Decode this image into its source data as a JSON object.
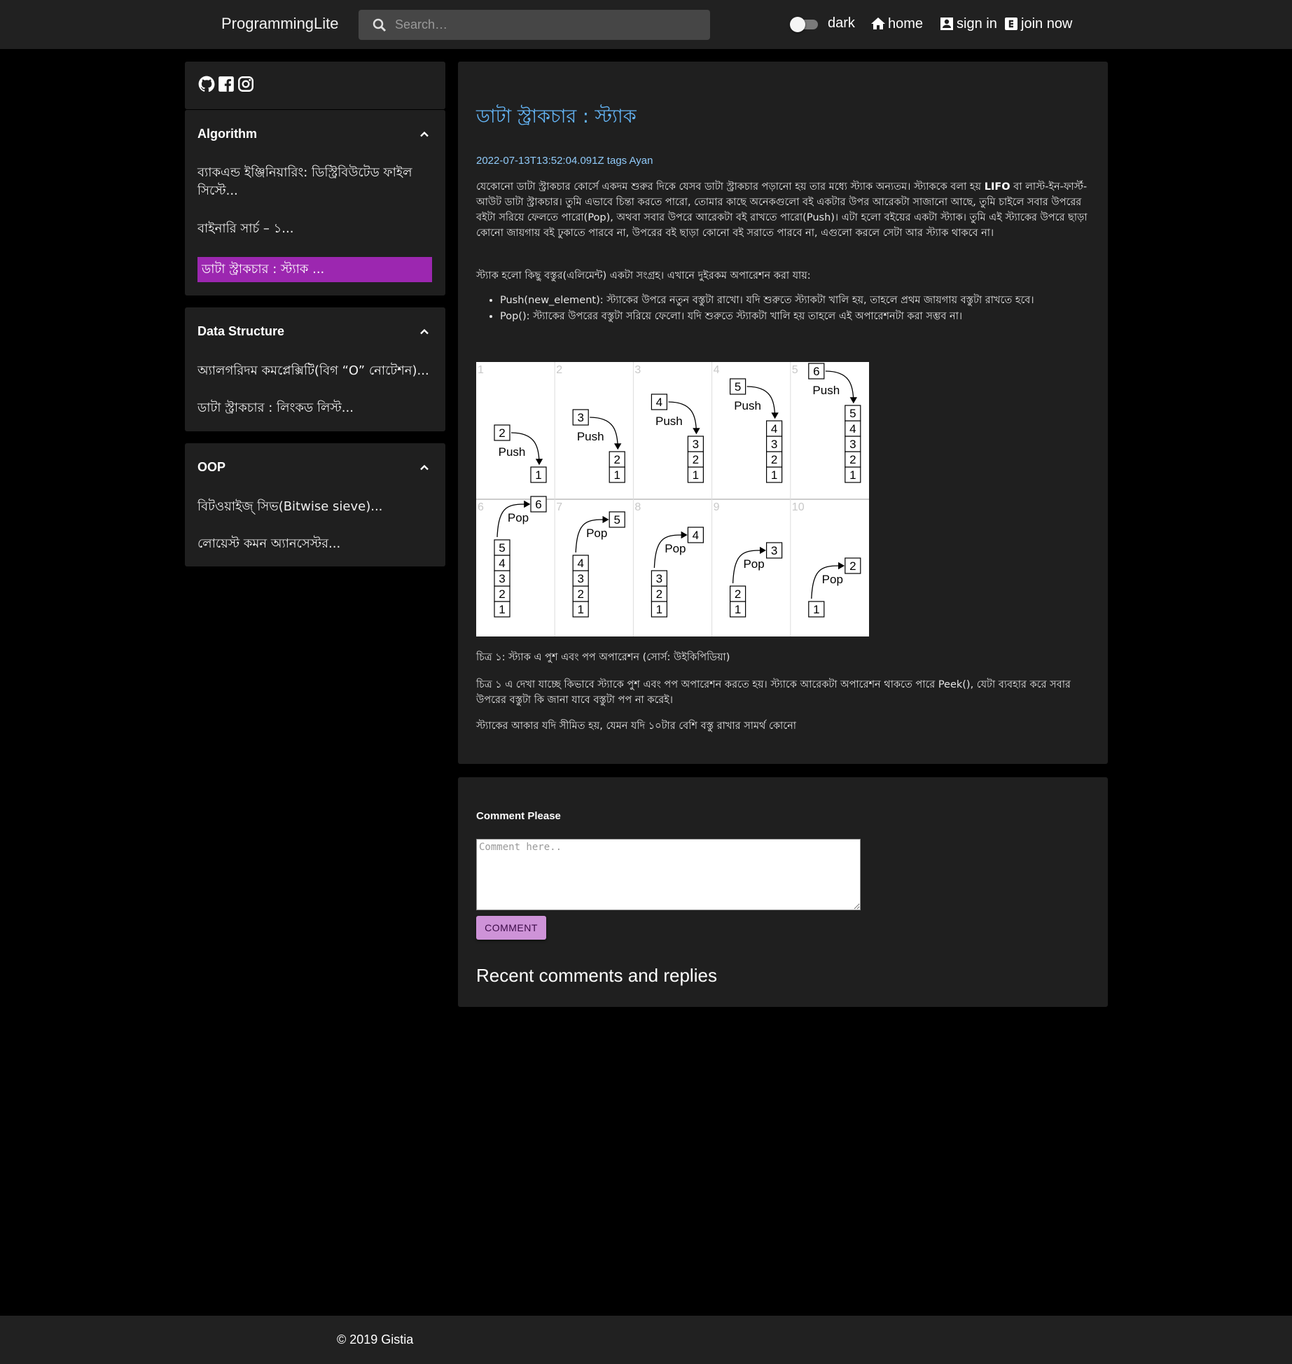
{
  "navbar": {
    "brand": "ProgrammingLite",
    "search_placeholder": "Search…",
    "dark_label": "dark",
    "home_label": "home",
    "signin_label": "sign in",
    "join_label": "join now"
  },
  "sidebar": {
    "sections": [
      {
        "title": "Algorithm",
        "items": [
          "ব্যাকএন্ড ইঞ্জিনিয়ারিং: ডিস্ট্রিবিউটেড ফাইল সিস্টে...",
          "বাইনারি সার্চ – ১...",
          "ডাটা স্ট্রাকচার : স্ট্যাক ..."
        ],
        "active_index": 2
      },
      {
        "title": "Data Structure",
        "items": [
          "অ্যালগরিদম কমপ্লেক্সিটি(বিগ “O” নোটেশন)...",
          "ডাটা স্ট্রাকচার : লিংকড লিস্ট..."
        ]
      },
      {
        "title": "OOP",
        "items": [
          "বিটওয়াইজ্ সিভ(Bitwise sieve)...",
          "লোয়েস্ট কমন অ্যানসেস্টর..."
        ]
      }
    ]
  },
  "article": {
    "title": "ডাটা স্ট্রাকচার : স্ট্যাক",
    "meta": "2022-07-13T13:52:04.091Z tags Ayan",
    "intro_before": "যেকোনো ডাটা স্ট্রাকচার কোর্সে একদম শুরুর দিকে যেসব ডাটা স্ট্রাকচার পড়ানো হয় তার মধ্যে স্ট্যাক অন্যতম। স্ট্যাককে বলা হয় ",
    "intro_bold": "LIFO",
    "intro_after": " বা লাস্ট-ইন-ফার্স্ট-আউট ডাটা স্ট্রাকচার। তুমি এভাবে চিন্তা করতে পারো, তোমার কাছে অনেকগুলো বই একটার উপর আরেকটা সাজানো আছে, তুমি চাইলে সবার উপরের বইটা সরিয়ে ফেলতে পারো(Pop), অথবা সবার উপরে আরেকটা বই রাখতে পারো(Push)। এটা হলো বইয়ের একটা স্ট্যাক। তুমি এই স্ট্যাকের উপরে ছাড়া কোনো জায়গায় বই ঢুকাতে পারবে না, উপরের বই ছাড়া কোনো বই সরাতে পারবে না, এগুলো করলে সেটা আর স্ট্যাক থাকবে না।",
    "collection": "স্ট্যাক হলো কিছু বস্তুর(এলিমেন্ট) একটা সংগ্রহ। এখানে দুইরকম অপারেশন করা যায়:",
    "operations": [
      "Push(new_element): স্ট্যাকের উপরে নতুন বস্তুটা রাখো। যদি শুরুতে স্ট্যাকটা খালি হয়, তাহলে প্রথম জায়গায় বস্তুটা রাখতে হবে।",
      "Pop(): স্ট্যাকের উপরের বস্তুটা সরিয়ে ফেলো। যদি শুরুতে স্ট্যাকটা খালি হয় তাহলে এই অপারেশনটা করা সম্ভব না।"
    ],
    "caption": "চিত্র ১: স্ট্যাক এ পুশ এবং পপ অপারেশন (সোর্স: উইকিপিডিয়া)",
    "peek_para": "চিত্র ১ এ দেখা যাচ্ছে কিভাবে স্ট্যাকে পুশ এবং পপ অপারেশন করতে হয়। স্ট্যাকে আরেকটা অপারেশন থাকতে পারে Peek(), যেটা ব্যবহার করে সবার উপরের বস্তুটা কি জানা যাবে বস্তুটা পপ না করেই।",
    "limit_para": "স্ট্যাকের আকার যদি সীমিত হয়, যেমন যদি ১০টার বেশি বস্তু রাখার সামর্থ কোনো"
  },
  "diagram": {
    "push_label": "Push",
    "pop_label": "Pop",
    "frames": [
      {
        "n": "1",
        "op": "push",
        "item": "2",
        "stack": [
          "1"
        ]
      },
      {
        "n": "2",
        "op": "push",
        "item": "3",
        "stack": [
          "1",
          "2"
        ]
      },
      {
        "n": "3",
        "op": "push",
        "item": "4",
        "stack": [
          "1",
          "2",
          "3"
        ]
      },
      {
        "n": "4",
        "op": "push",
        "item": "5",
        "stack": [
          "1",
          "2",
          "3",
          "4"
        ]
      },
      {
        "n": "5",
        "op": "push",
        "item": "6",
        "stack": [
          "1",
          "2",
          "3",
          "4",
          "5"
        ]
      },
      {
        "n": "6",
        "op": "pop",
        "item": "6",
        "stack": [
          "1",
          "2",
          "3",
          "4",
          "5"
        ]
      },
      {
        "n": "7",
        "op": "pop",
        "item": "5",
        "stack": [
          "1",
          "2",
          "3",
          "4"
        ]
      },
      {
        "n": "8",
        "op": "pop",
        "item": "4",
        "stack": [
          "1",
          "2",
          "3"
        ]
      },
      {
        "n": "9",
        "op": "pop",
        "item": "3",
        "stack": [
          "1",
          "2"
        ]
      },
      {
        "n": "10",
        "op": "pop",
        "item": "2",
        "stack": [
          "1"
        ]
      }
    ]
  },
  "comments": {
    "label": "Comment Please",
    "placeholder": "Comment here..",
    "button": "COMMENT",
    "recent_title": "Recent comments and replies"
  },
  "footer": {
    "copyright": "© 2019 Gistia"
  },
  "colors": {
    "accent": "#9c27b0",
    "title_blue": "#64b5f6",
    "button": "#ce93d8"
  }
}
